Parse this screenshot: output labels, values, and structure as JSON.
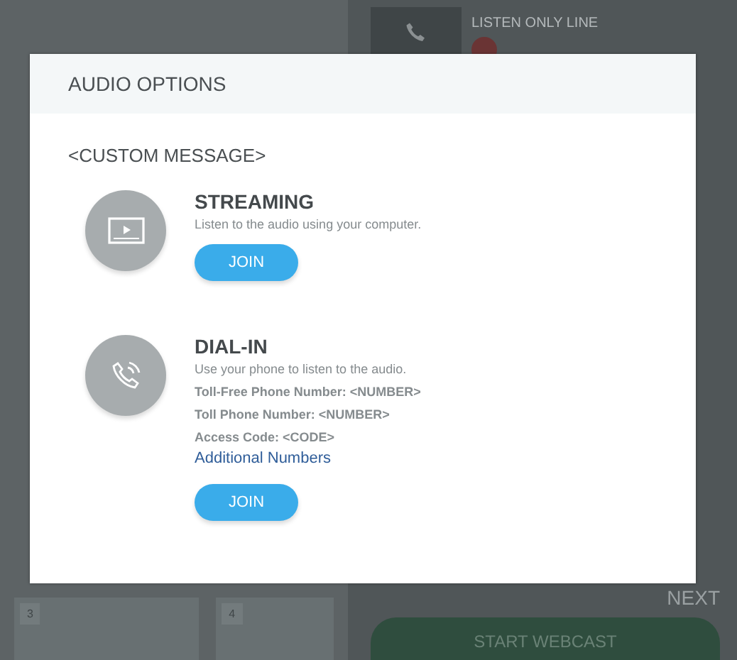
{
  "background": {
    "line_title": "LISTEN ONLY LINE",
    "next_label": "NEXT",
    "cards": [
      {
        "number": "3"
      },
      {
        "number": "4"
      }
    ],
    "start_button": "START WEBCAST"
  },
  "dialog": {
    "title": "AUDIO OPTIONS",
    "message": "<CUSTOM MESSAGE>",
    "options": [
      {
        "kind": "streaming",
        "title": "STREAMING",
        "lines": [
          "Listen to the audio using your computer."
        ],
        "button": "JOIN"
      },
      {
        "kind": "dial-in",
        "title": "DIAL-IN",
        "lines": [
          "Use your phone to listen to the audio.",
          "Toll-Free Phone Number: <NUMBER>",
          "Toll Phone Number: <NUMBER>",
          "Access Code: <CODE>"
        ],
        "link": "Additional Numbers",
        "button": "JOIN"
      }
    ]
  }
}
